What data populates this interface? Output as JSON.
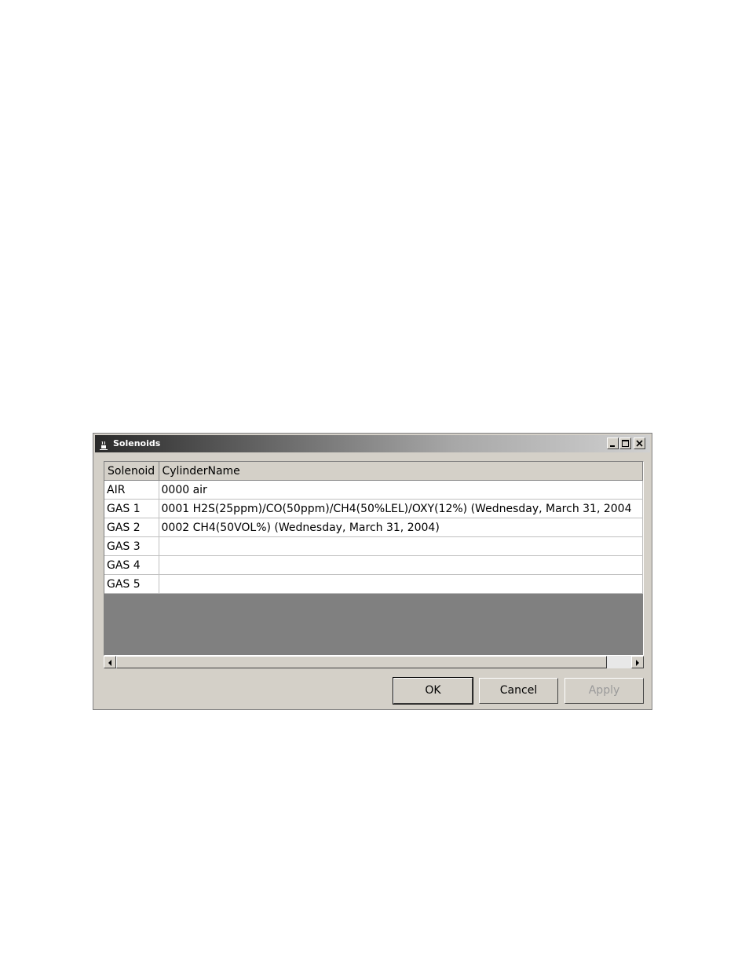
{
  "window": {
    "title": "Solenoids",
    "icon": "java-cup-icon"
  },
  "table": {
    "columns": [
      "Solenoid",
      "CylinderName"
    ],
    "rows": [
      {
        "solenoid": "AIR",
        "cylinder": "0000 air"
      },
      {
        "solenoid": "GAS 1",
        "cylinder": "0001 H2S(25ppm)/CO(50ppm)/CH4(50%LEL)/OXY(12%) (Wednesday, March 31, 2004"
      },
      {
        "solenoid": "GAS 2",
        "cylinder": "0002 CH4(50VOL%) (Wednesday, March 31, 2004)"
      },
      {
        "solenoid": "GAS 3",
        "cylinder": ""
      },
      {
        "solenoid": "GAS 4",
        "cylinder": ""
      },
      {
        "solenoid": "GAS 5",
        "cylinder": ""
      }
    ]
  },
  "buttons": {
    "ok": "OK",
    "cancel": "Cancel",
    "apply": "Apply"
  }
}
